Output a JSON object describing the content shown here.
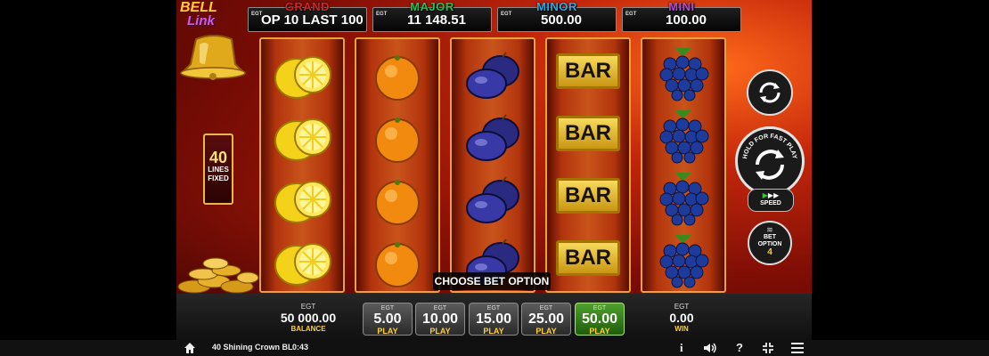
{
  "jackpots": [
    {
      "name": "GRAND",
      "color": "#e02020",
      "egt": "EGT",
      "value": "OP 10     LAST 100"
    },
    {
      "name": "MAJOR",
      "color": "#27c24a",
      "egt": "EGT",
      "value": "11 148.51"
    },
    {
      "name": "MINOR",
      "color": "#2aa8e8",
      "egt": "EGT",
      "value": "500.00"
    },
    {
      "name": "MINI",
      "color": "#b94ad8",
      "egt": "EGT",
      "value": "100.00"
    }
  ],
  "logo": {
    "word1": "BELL",
    "word2": "Link"
  },
  "lines": {
    "count": "40",
    "label1": "LINES",
    "label2": "FIXED"
  },
  "reels": [
    {
      "symbol": "lemon-icon"
    },
    {
      "symbol": "orange-icon"
    },
    {
      "symbol": "plum-icon"
    },
    {
      "symbol": "bar-icon",
      "text": "BAR"
    },
    {
      "symbol": "grapes-icon"
    }
  ],
  "controls": {
    "hold_label": "HOLD FOR FAST PLAY",
    "speed_label": "SPEED",
    "bet_option_label1": "BET",
    "bet_option_label2": "OPTION",
    "bet_option_value": "4",
    "choose_bet": "CHOOSE BET OPTION"
  },
  "balance": {
    "egt": "EGT",
    "value": "50 000.00",
    "label": "BALANCE"
  },
  "win": {
    "egt": "EGT",
    "value": "0.00",
    "label": "WIN"
  },
  "bets": [
    {
      "egt": "EGT",
      "value": "5.00",
      "label": "PLAY",
      "active": false
    },
    {
      "egt": "EGT",
      "value": "10.00",
      "label": "PLAY",
      "active": false
    },
    {
      "egt": "EGT",
      "value": "15.00",
      "label": "PLAY",
      "active": false
    },
    {
      "egt": "EGT",
      "value": "25.00",
      "label": "PLAY",
      "active": false
    },
    {
      "egt": "EGT",
      "value": "50.00",
      "label": "PLAY",
      "active": true
    }
  ],
  "status_bar": {
    "game_title": "40 Shining Crown BL",
    "time": "0:43",
    "info_icon": "i",
    "help_icon": "?"
  }
}
